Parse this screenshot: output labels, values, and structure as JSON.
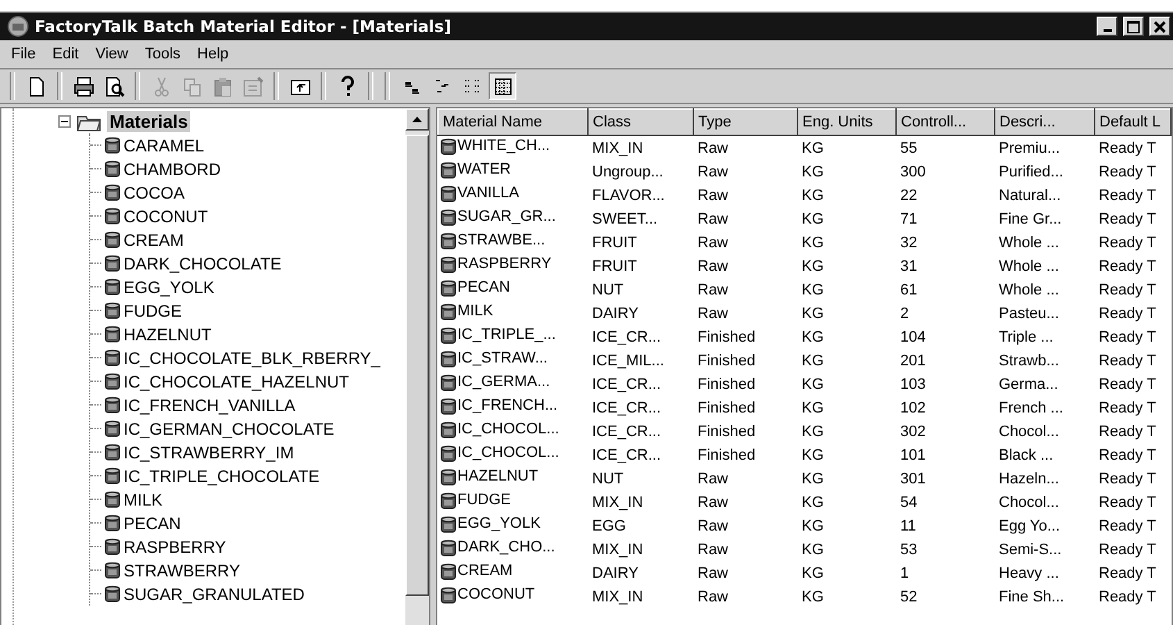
{
  "window": {
    "title": "FactoryTalk Batch Material Editor - [Materials]"
  },
  "menu": [
    "File",
    "Edit",
    "View",
    "Tools",
    "Help"
  ],
  "toolbar": [
    {
      "kind": "sep"
    },
    {
      "kind": "new",
      "disabled": false,
      "pressed": false
    },
    {
      "kind": "sep"
    },
    {
      "kind": "print",
      "disabled": false,
      "pressed": false
    },
    {
      "kind": "preview",
      "disabled": false,
      "pressed": false
    },
    {
      "kind": "sep"
    },
    {
      "kind": "cut",
      "disabled": true,
      "pressed": false
    },
    {
      "kind": "copy",
      "disabled": true,
      "pressed": false
    },
    {
      "kind": "paste",
      "disabled": true,
      "pressed": false
    },
    {
      "kind": "properties",
      "disabled": true,
      "pressed": false
    },
    {
      "kind": "sep"
    },
    {
      "kind": "up",
      "disabled": false,
      "pressed": false
    },
    {
      "kind": "sep"
    },
    {
      "kind": "help",
      "disabled": false,
      "pressed": false
    },
    {
      "kind": "sep"
    },
    {
      "kind": "sep"
    },
    {
      "kind": "large",
      "disabled": false,
      "pressed": false
    },
    {
      "kind": "small",
      "disabled": false,
      "pressed": false
    },
    {
      "kind": "list",
      "disabled": false,
      "pressed": false
    },
    {
      "kind": "details",
      "disabled": false,
      "pressed": true
    }
  ],
  "tree": {
    "label": "Materials",
    "expanded": true,
    "selected": true,
    "children": [
      {
        "label": "CARAMEL",
        "selected": false
      },
      {
        "label": "CHAMBORD",
        "selected": false
      },
      {
        "label": "COCOA",
        "selected": false
      },
      {
        "label": "COCONUT",
        "selected": false
      },
      {
        "label": "CREAM",
        "selected": false
      },
      {
        "label": "DARK_CHOCOLATE",
        "selected": false
      },
      {
        "label": "EGG_YOLK",
        "selected": false
      },
      {
        "label": "FUDGE",
        "selected": false
      },
      {
        "label": "HAZELNUT",
        "selected": false
      },
      {
        "label": "IC_CHOCOLATE_BLK_RBERRY_",
        "selected": false
      },
      {
        "label": "IC_CHOCOLATE_HAZELNUT",
        "selected": false
      },
      {
        "label": "IC_FRENCH_VANILLA",
        "selected": false
      },
      {
        "label": "IC_GERMAN_CHOCOLATE",
        "selected": false
      },
      {
        "label": "IC_STRAWBERRY_IM",
        "selected": false
      },
      {
        "label": "IC_TRIPLE_CHOCOLATE",
        "selected": false
      },
      {
        "label": "MILK",
        "selected": false
      },
      {
        "label": "PECAN",
        "selected": false
      },
      {
        "label": "RASPBERRY",
        "selected": false
      },
      {
        "label": "STRAWBERRY",
        "selected": false
      },
      {
        "label": "SUGAR_GRANULATED",
        "selected": false
      }
    ]
  },
  "table": {
    "columns": [
      "Material Name",
      "Class",
      "Type",
      "Eng. Units",
      "Controll...",
      "Descri...",
      "Default L"
    ],
    "rows": [
      [
        "WHITE_CH...",
        "MIX_IN",
        "Raw",
        "KG",
        "55",
        "Premiu...",
        "Ready T"
      ],
      [
        "WATER",
        "Ungroup...",
        "Raw",
        "KG",
        "300",
        "Purified...",
        "Ready T"
      ],
      [
        "VANILLA",
        "FLAVOR...",
        "Raw",
        "KG",
        "22",
        "Natural...",
        "Ready T"
      ],
      [
        "SUGAR_GR...",
        "SWEET...",
        "Raw",
        "KG",
        "71",
        "Fine Gr...",
        "Ready T"
      ],
      [
        "STRAWBE...",
        "FRUIT",
        "Raw",
        "KG",
        "32",
        "Whole ...",
        "Ready T"
      ],
      [
        "RASPBERRY",
        "FRUIT",
        "Raw",
        "KG",
        "31",
        "Whole ...",
        "Ready T"
      ],
      [
        "PECAN",
        "NUT",
        "Raw",
        "KG",
        "61",
        "Whole ...",
        "Ready T"
      ],
      [
        "MILK",
        "DAIRY",
        "Raw",
        "KG",
        "2",
        "Pasteu...",
        "Ready T"
      ],
      [
        "IC_TRIPLE_...",
        "ICE_CR...",
        "Finished",
        "KG",
        "104",
        "Triple ...",
        "Ready T"
      ],
      [
        "IC_STRAW...",
        "ICE_MIL...",
        "Finished",
        "KG",
        "201",
        "Strawb...",
        "Ready T"
      ],
      [
        "IC_GERMA...",
        "ICE_CR...",
        "Finished",
        "KG",
        "103",
        "Germa...",
        "Ready T"
      ],
      [
        "IC_FRENCH...",
        "ICE_CR...",
        "Finished",
        "KG",
        "102",
        "French ...",
        "Ready T"
      ],
      [
        "IC_CHOCOL...",
        "ICE_CR...",
        "Finished",
        "KG",
        "302",
        "Chocol...",
        "Ready T"
      ],
      [
        "IC_CHOCOL...",
        "ICE_CR...",
        "Finished",
        "KG",
        "101",
        "Black ...",
        "Ready T"
      ],
      [
        "HAZELNUT",
        "NUT",
        "Raw",
        "KG",
        "301",
        "Hazeln...",
        "Ready T"
      ],
      [
        "FUDGE",
        "MIX_IN",
        "Raw",
        "KG",
        "54",
        "Chocol...",
        "Ready T"
      ],
      [
        "EGG_YOLK",
        "EGG",
        "Raw",
        "KG",
        "11",
        "Egg Yo...",
        "Ready T"
      ],
      [
        "DARK_CHO...",
        "MIX_IN",
        "Raw",
        "KG",
        "53",
        "Semi-S...",
        "Ready T"
      ],
      [
        "CREAM",
        "DAIRY",
        "Raw",
        "KG",
        "1",
        "Heavy ...",
        "Ready T"
      ],
      [
        "COCONUT",
        "MIX_IN",
        "Raw",
        "KG",
        "52",
        "Fine Sh...",
        "Ready T"
      ]
    ]
  }
}
